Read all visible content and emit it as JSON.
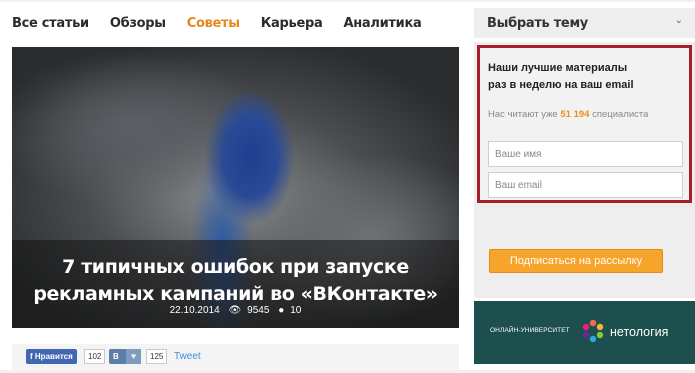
{
  "nav": {
    "items": [
      {
        "label": "Все статьи",
        "active": false
      },
      {
        "label": "Обзоры",
        "active": false
      },
      {
        "label": "Советы",
        "active": true
      },
      {
        "label": "Карьера",
        "active": false
      },
      {
        "label": "Аналитика",
        "active": false
      }
    ]
  },
  "hero": {
    "title": "7 типичных ошибок при запуске рекламных кампаний во «ВКонтакте»",
    "date": "22.10.2014",
    "views": "9545",
    "comments": "10"
  },
  "social": {
    "fb_label": "Нравится",
    "fb_count": "102",
    "vk_label": "В",
    "vk_count": "125",
    "tweet_label": "Tweet"
  },
  "sidebar": {
    "topic_label": "Выбрать тему",
    "subscribe": {
      "title_line1": "Наши лучшие материалы",
      "title_line2": "раз в неделю на ваш email",
      "count_prefix": "Нас читают уже",
      "count_value": "51 194",
      "count_suffix": "специалиста",
      "name_placeholder": "Ваше имя",
      "email_placeholder": "Ваш email",
      "button_label": "Подписаться на рассылку"
    },
    "promo": {
      "small_text": "ОНЛАЙН-УНИВЕРСИТЕТ",
      "brand": "нетология"
    }
  },
  "colors": {
    "accent": "#e8871e",
    "frame": "#a81c2b",
    "button": "#f7a42a",
    "promo_bg": "#1d4f4f"
  }
}
